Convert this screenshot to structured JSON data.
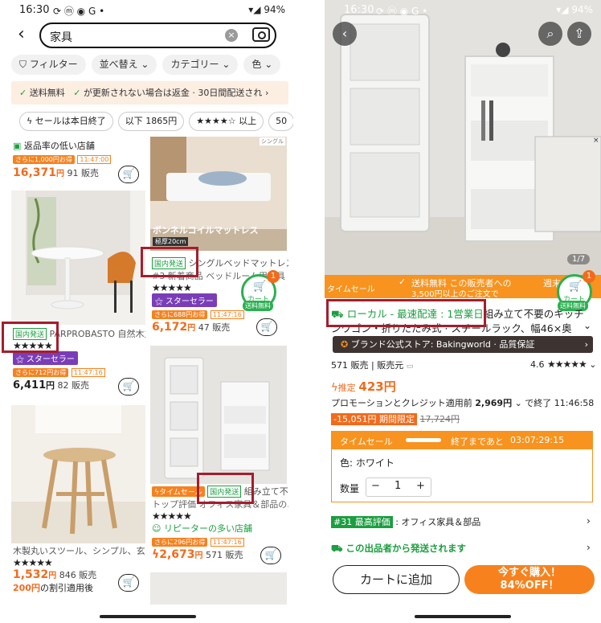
{
  "left": {
    "status": {
      "time": "16:30",
      "battery": "94%",
      "icons": "⟳ ⓜ ◉ G •"
    },
    "search": {
      "query": "家具"
    },
    "filters": [
      "フィルター",
      "並べ替え",
      "カテゴリー",
      "色"
    ],
    "banner": {
      "item1": "送料無料",
      "item2": "が更新されない場合は返金 · 30日間配送され"
    },
    "quick_pills": [
      "セールは本日終了",
      "以下 1865円",
      "★★★★☆ 以上",
      "50"
    ],
    "store_label": "返品率の低い店舗",
    "cards": {
      "c1": {
        "deal": "さらに1,000円お得",
        "timer": "11:47:00",
        "price": "16,371",
        "yen": "円",
        "sold": "91 販売"
      },
      "c2": {
        "img_text": "ボンネルコイルマットレス",
        "size": "極厚20cm",
        "tag": "シングル",
        "domestic": "国内発送",
        "title": "シングルベッドマットレス",
        "title2": "#3 新着商品 ベッドルーム用家具",
        "stars": "★★★★★",
        "seller": "スターセラー",
        "deal": "さらに688円お得",
        "timer": "11:47:16",
        "price": "6,172",
        "yen": "円",
        "sold": "47 販売"
      },
      "c3": {
        "domestic": "国内発送",
        "title": "PARPROBASTO 自然木丸テーブル",
        "stars": "★★★★★",
        "seller": "スターセラー",
        "deal": "さらに712円お得",
        "timer": "11:47:16",
        "price": "6,411",
        "yen": "円",
        "sold": "82 販売"
      },
      "c4": {
        "title": "木製丸いスツール、シンプル、玄関...",
        "stars": "★★★★★",
        "price": "1,532",
        "yen": "円",
        "sold": "846 販売",
        "discount_amt": "200円",
        "discount": "の割引適用後"
      },
      "c5": {
        "timesale": "タイムセール",
        "domestic": "国内発送",
        "title": "組み立て不...",
        "title2": "トップ評価 オフィス家具＆部品の...",
        "stars": "★★★★★",
        "seller": "リピーターの多い店舗",
        "deal": "さらに296円お得",
        "timer": "11:47:16",
        "price": "2,673",
        "yen": "円",
        "sold": "571 販売"
      }
    },
    "float_cart": {
      "count": "1",
      "label": "カート",
      "ship": "送料無料"
    }
  },
  "right": {
    "status": {
      "time": "16:30",
      "battery": "94%"
    },
    "pager": "1/7",
    "sale_band": {
      "label": "タイムセール",
      "text1": "送料無料 この販売者への",
      "text2": "3,500円以上のご注文で",
      "right": "週末"
    },
    "float_cart": {
      "count": "1",
      "label": "カート",
      "ship": "送料無料"
    },
    "delivery": {
      "label": "ローカル - 最速配達 : 1営業日",
      "rest": "組み立て不要のキッチ"
    },
    "title2": "ンワゴン・折りたたみ式 · スチールラック、幅46×奥",
    "brand": "ブランド公式ストア: Bakingworld · 品質保証",
    "sold": "571 販売",
    "seller": "販売元",
    "rating": "4.6",
    "stars": "★★★★★",
    "est_label": "推定",
    "est_price": "423円",
    "promo": "プロモーションとクレジット適用前",
    "promo_price": "2,969円",
    "end_time": "で終了 11:46:58",
    "limit": "-15,051円 期間限定",
    "old_price": "17,724円",
    "timesale": {
      "label": "タイムセール",
      "until": "終了まであと",
      "countdown": "03:07:29:15"
    },
    "color_label": "色: ホワイト",
    "qty": {
      "label": "数量",
      "value": "1",
      "minus": "−",
      "plus": "+"
    },
    "rank": {
      "badge": "#31 最高評価",
      "text": ": オフィス家具＆部品"
    },
    "ship_note": "この出品者から発送されます",
    "add_cart": "カートに追加",
    "buy_now": "今すぐ購入！",
    "buy_now_sub": "84%OFF！"
  },
  "colors": {
    "accent": "#f26b1b",
    "green": "#1a9e3f",
    "highlight_box": "#a51d2d",
    "purple": "#7a3db8"
  }
}
